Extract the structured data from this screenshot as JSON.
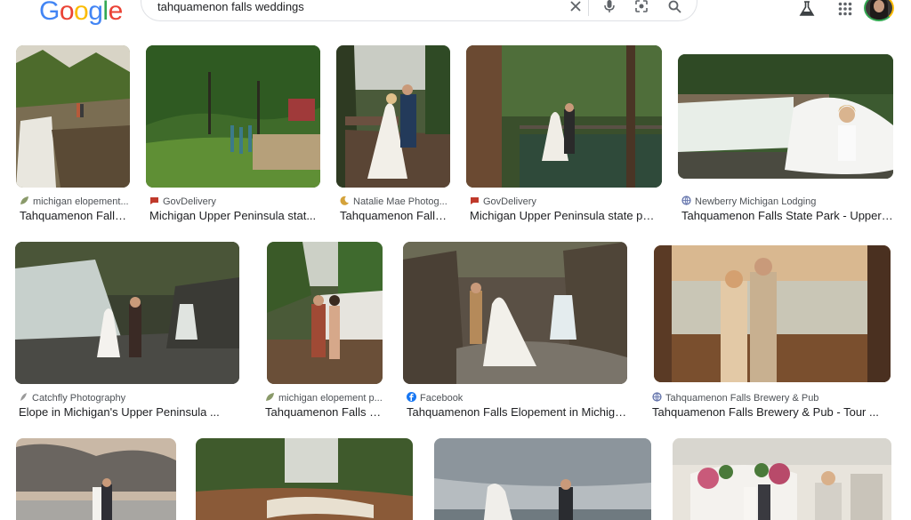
{
  "header": {
    "logo_text": "Google",
    "search_query": "tahquamenon falls weddings",
    "colors": {
      "blue": "#4285f4",
      "red": "#ea4335",
      "yellow": "#fbbc05",
      "green": "#34a853"
    },
    "icons": [
      "clear-icon",
      "microphone-icon",
      "lens-icon",
      "search-icon",
      "labs-flask-icon",
      "apps-grid-icon",
      "avatar"
    ]
  },
  "results": [
    {
      "source": "michigan elopement...",
      "title": "Tahquamenon Falls...",
      "favicon": "leaf-icon"
    },
    {
      "source": "GovDelivery",
      "title": "Michigan Upper Peninsula stat...",
      "favicon": "govdelivery-icon"
    },
    {
      "source": "Natalie Mae Photog...",
      "title": "Tahquamenon Falls...",
      "favicon": "moon-icon"
    },
    {
      "source": "GovDelivery",
      "title": "Michigan Upper Peninsula state par...",
      "favicon": "govdelivery-icon"
    },
    {
      "source": "Newberry Michigan Lodging",
      "title": "Tahquamenon Falls State Park - Upper ...",
      "favicon": "globe-icon"
    },
    {
      "source": "Catchfly Photography",
      "title": "Elope in Michigan's Upper Peninsula ...",
      "favicon": "feather-icon"
    },
    {
      "source": "michigan elopement p...",
      "title": "Tahquamenon Falls C...",
      "favicon": "leaf-icon"
    },
    {
      "source": "Facebook",
      "title": "Tahquamenon Falls Elopement in Michiga...",
      "favicon": "facebook-icon"
    },
    {
      "source": "Tahquamenon Falls Brewery & Pub",
      "title": "Tahquamenon Falls Brewery & Pub - Tour ...",
      "favicon": "globe-icon"
    },
    {
      "source": "",
      "title": "",
      "favicon": ""
    },
    {
      "source": "",
      "title": "",
      "favicon": ""
    },
    {
      "source": "",
      "title": "",
      "favicon": ""
    },
    {
      "source": "",
      "title": "",
      "favicon": ""
    }
  ]
}
